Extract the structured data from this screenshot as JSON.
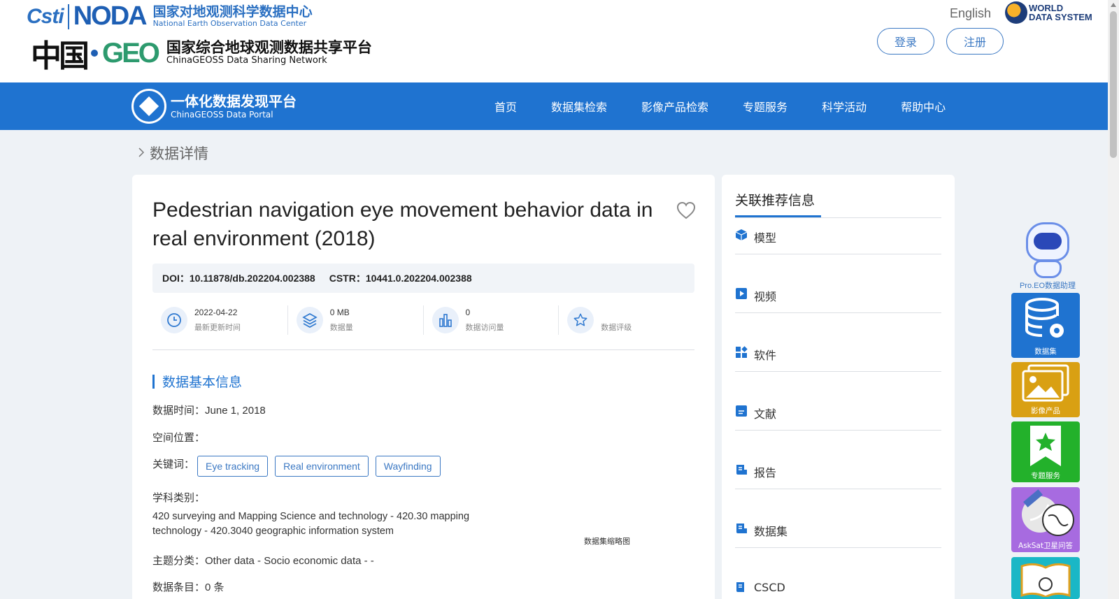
{
  "header": {
    "logo1": {
      "cstr": "Csti",
      "noda": "NODA",
      "cn": "国家对地观测科学数据中心",
      "en": "National Earth Observation Data Center"
    },
    "logo2": {
      "mark_zh": "中国",
      "mark_geo": "GEO",
      "cn": "国家综合地球观测数据共享平台",
      "en": "ChinaGEOSS Data Sharing Network"
    },
    "language": "English",
    "wds": {
      "line1": "WORLD",
      "line2": "DATA SYSTEM"
    },
    "login_label": "登录",
    "register_label": "注册"
  },
  "nav": {
    "portal_cn": "一体化数据发现平台",
    "portal_en": "ChinaGEOSS Data Portal",
    "items": [
      "首页",
      "数据集检索",
      "影像产品检索",
      "专题服务",
      "科学活动",
      "帮助中心"
    ]
  },
  "breadcrumb": {
    "label": "数据详情"
  },
  "dataset": {
    "title": "Pedestrian navigation eye movement behavior data in real environment (2018)",
    "doi_label": "DOI",
    "doi_value": "10.11878/db.202204.002388",
    "cstr_label": "CSTR",
    "cstr_value": "10441.0.202204.002388",
    "sep": "：",
    "stats": [
      {
        "icon": "clock-icon",
        "value": "2022-04-22",
        "label": "最新更新时间"
      },
      {
        "icon": "layers-icon",
        "value": "0 MB",
        "label": "数据量"
      },
      {
        "icon": "bar-chart-icon",
        "value": "0",
        "label": "数据访问量"
      },
      {
        "icon": "star-icon",
        "value": "",
        "label": "数据评级"
      }
    ],
    "section_title": "数据基本信息",
    "data_time_label": "数据时间：",
    "data_time_value": "June 1, 2018",
    "location_label": "空间位置：",
    "keywords_label": "关键词：",
    "keywords": [
      "Eye tracking",
      "Real environment",
      "Wayfinding"
    ],
    "subject_label": "学科类别：",
    "subject_value": "420 surveying and Mapping Science and technology - 420.30 mapping technology - 420.3040 geographic information system",
    "theme_label": "主题分类：",
    "theme_value": "Other data - Socio economic data - -",
    "records_label": "数据条目：",
    "records_value": "0 条",
    "thumbnail_caption": "数据集缩略图"
  },
  "recommend": {
    "title": "关联推荐信息",
    "items": [
      "模型",
      "视频",
      "软件",
      "文献",
      "报告",
      "数据集",
      "CSCD"
    ]
  },
  "tools": {
    "assistant_label": "Pro.EO数据助理",
    "tiles": [
      {
        "label": "数据集",
        "color": "#1f73d0"
      },
      {
        "label": "影像产品",
        "color": "#d9a013"
      },
      {
        "label": "专题服务",
        "color": "#23b12b"
      },
      {
        "label": "AskSat卫星问答",
        "color": "#a76be0"
      },
      {
        "label": "",
        "color": "#1ab7c6"
      }
    ]
  },
  "colors": {
    "primary": "#1f73d0",
    "page_bg": "#eef2f6"
  }
}
